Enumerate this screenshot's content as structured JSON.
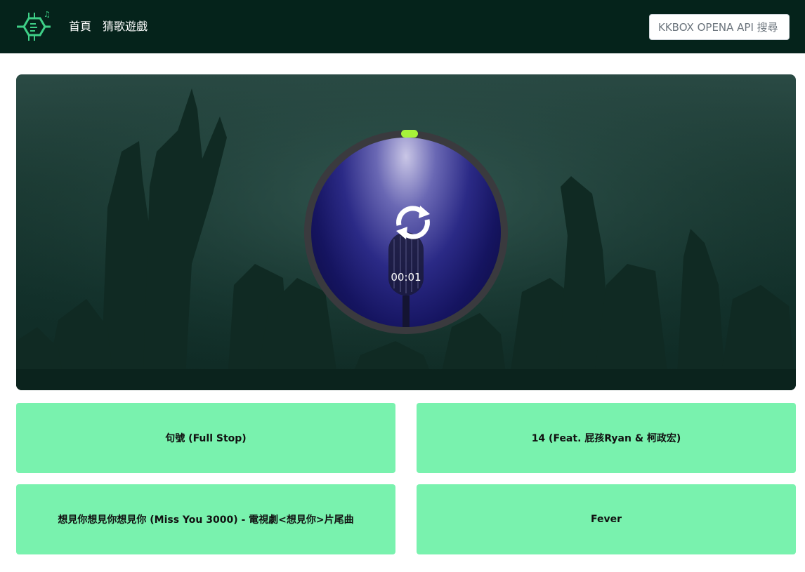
{
  "nav": {
    "logo_icon": "kkbox-hexagon-logo-icon",
    "links": [
      "首頁",
      "猜歌遊戲"
    ],
    "search_placeholder": "KKBOX OPENA API 搜尋"
  },
  "player": {
    "timer": "00:01",
    "icon": "replay-icon",
    "progress_color": "#a6f23a"
  },
  "options": [
    "句號 (Full Stop)",
    "14 (Feat. 屁孩Ryan & 柯政宏)",
    "想見你想見你想見你 (Miss You 3000) - 電視劇<想見你>片尾曲",
    "Fever"
  ],
  "colors": {
    "navbar": "#05231b",
    "option_bg": "#79f2ae",
    "accent": "#a6f23a"
  }
}
